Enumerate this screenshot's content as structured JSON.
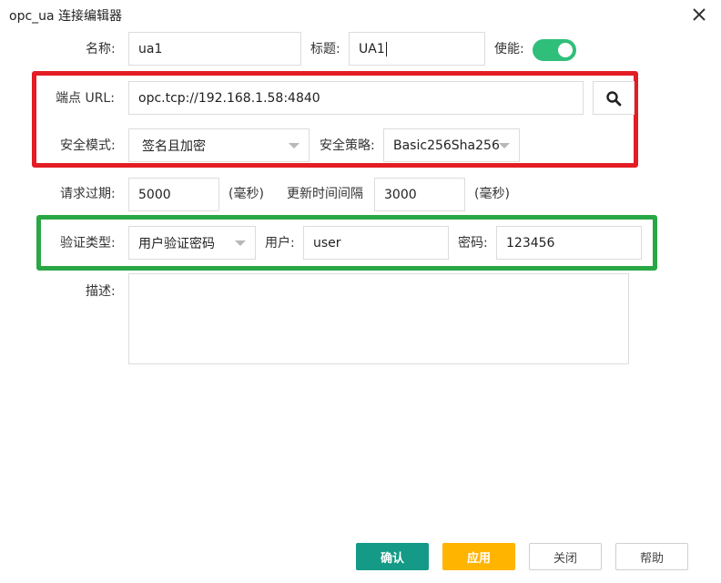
{
  "dialog": {
    "title": "opc_ua 连接编辑器"
  },
  "row1": {
    "name_label": "名称:",
    "name_value": "ua1",
    "title_label": "标题:",
    "title_value": "UA1",
    "enable_label": "使能:",
    "enabled": true
  },
  "endpoint": {
    "label": "端点 URL:",
    "value": "opc.tcp://192.168.1.58:4840",
    "search_icon": "search-icon"
  },
  "security": {
    "mode_label": "安全模式:",
    "mode_value": "签名且加密",
    "policy_label": "安全策略:",
    "policy_value": "Basic256Sha256"
  },
  "timing": {
    "request_label": "请求过期:",
    "request_value": "5000",
    "request_unit": "(毫秒)",
    "update_label": "更新时间间隔",
    "update_value": "3000",
    "update_unit": "(毫秒)"
  },
  "auth": {
    "type_label": "验证类型:",
    "type_value": "用户验证密码",
    "user_label": "用户:",
    "user_value": "user",
    "password_label": "密码:",
    "password_value": "123456"
  },
  "description": {
    "label": "描述:",
    "value": ""
  },
  "buttons": {
    "ok": "确认",
    "apply": "应用",
    "close": "关闭",
    "help": "帮助"
  },
  "colors": {
    "highlight_red": "#e31d24",
    "highlight_green": "#2aa745",
    "toggle_on": "#2fbf7a",
    "ok_button": "#149a86",
    "apply_button": "#ffb400"
  }
}
